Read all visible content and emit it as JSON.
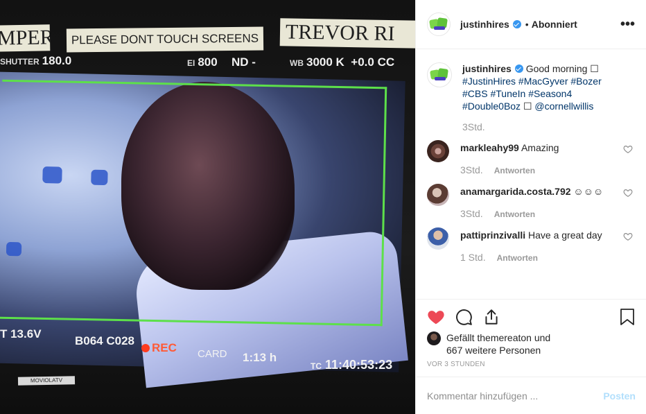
{
  "photo": {
    "tape_left": "MPER",
    "tape_middle": "PLEASE DONT TOUCH SCREENS",
    "tape_right": "TREVOR RI",
    "shutter_label": "SHUTTER",
    "shutter_value": "180.0",
    "ei_label": "EI",
    "ei_value": "800",
    "nd_label": "ND",
    "nd_value": "-",
    "wb_label": "WB",
    "wb_value": "3000 K",
    "wb_tint": "+0.0 CC",
    "voltage": "T 13.6V",
    "clip": "B064 C028",
    "rec": "REC",
    "card": "CARD",
    "duration": "1:13 h",
    "tc_label": "TC",
    "timecode": "11:40:53:23",
    "bezel_label": "MOVIOLATV"
  },
  "header": {
    "username": "justinhires",
    "separator": "•",
    "follow_state": "Abonniert",
    "more_icon": "more-horizontal-icon"
  },
  "caption": {
    "username": "justinhires",
    "text": "Good morning ☐",
    "tags": "#JustinHires #MacGyver #Bozer #CBS #TuneIn #Season4 #Double0Boz",
    "tail": "☐",
    "mention": "@cornellwillis",
    "time": "3Std."
  },
  "comments": [
    {
      "username": "markleahy99",
      "text": "Amazing",
      "time": "3Std.",
      "reply": "Antworten"
    },
    {
      "username": "anamargarida.costa.792",
      "text": "☺☺☺",
      "time": "3Std.",
      "reply": "Antworten"
    },
    {
      "username": "pattiprinzivalli",
      "text": "Have a great day",
      "time": "1 Std.",
      "reply": "Antworten"
    }
  ],
  "likes": {
    "prefix": "Gefällt",
    "user": "themereaton",
    "middle": "und",
    "others": "667 weitere Personen"
  },
  "timeago": "VOR 3 STUNDEN",
  "comment_box": {
    "placeholder": "Kommentar hinzufügen ...",
    "post_label": "Posten"
  },
  "colors": {
    "like_red": "#ed4956",
    "link_blue": "#003569",
    "verified_blue": "#3897f0",
    "post_disabled": "#b2dffc",
    "frame_green": "#5de04a"
  }
}
